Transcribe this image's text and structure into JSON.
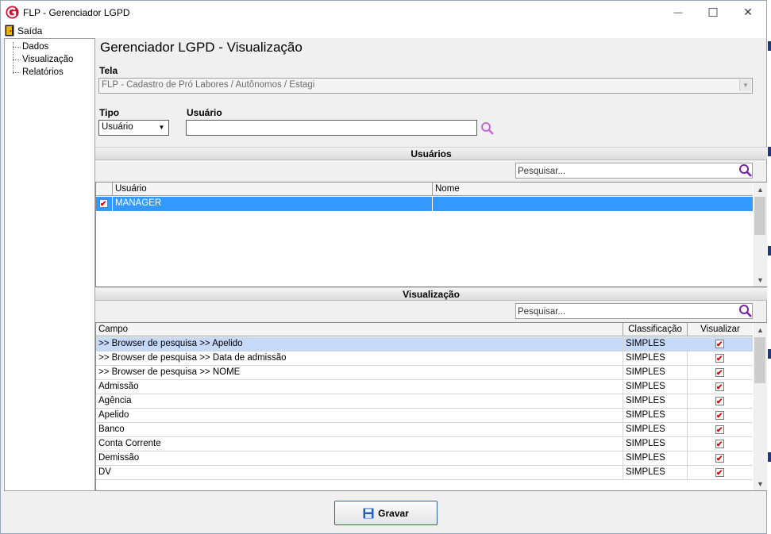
{
  "window": {
    "title": "FLP - Gerenciador LGPD",
    "minimize_glyph": "—",
    "maximize_glyph": "☐",
    "close_glyph": "✕"
  },
  "menu": {
    "exit_label": "Saída",
    "exit_icon": "door-exit-icon"
  },
  "tree": {
    "items": [
      {
        "label": "Dados"
      },
      {
        "label": "Visualização"
      },
      {
        "label": "Relatórios"
      }
    ]
  },
  "page": {
    "title": "Gerenciador LGPD - Visualização"
  },
  "tela": {
    "label": "Tela",
    "value": "FLP - Cadastro de Pró Labores / Autônomos / Estagi"
  },
  "tipo": {
    "label": "Tipo",
    "value": "Usuário"
  },
  "usuario": {
    "label": "Usuário",
    "value": ""
  },
  "usuarios_section": {
    "title": "Usuários",
    "search_placeholder": "Pesquisar...",
    "columns": [
      "Usuário",
      "Nome"
    ],
    "rows": [
      {
        "checked": true,
        "usuario": "MANAGER",
        "nome": ""
      }
    ]
  },
  "visualizacao_section": {
    "title": "Visualização",
    "search_placeholder": "Pesquisar...",
    "columns": [
      "Campo",
      "Classificação",
      "Visualizar"
    ],
    "rows": [
      {
        "campo": ">> Browser de pesquisa >> Apelido",
        "classificacao": "SIMPLES",
        "visualizar": true
      },
      {
        "campo": ">> Browser de pesquisa >> Data de admissão",
        "classificacao": "SIMPLES",
        "visualizar": true
      },
      {
        "campo": ">> Browser de pesquisa >> NOME",
        "classificacao": "SIMPLES",
        "visualizar": true
      },
      {
        "campo": "Admissão",
        "classificacao": "SIMPLES",
        "visualizar": true
      },
      {
        "campo": "Agência",
        "classificacao": "SIMPLES",
        "visualizar": true
      },
      {
        "campo": "Apelido",
        "classificacao": "SIMPLES",
        "visualizar": true
      },
      {
        "campo": "Banco",
        "classificacao": "SIMPLES",
        "visualizar": true
      },
      {
        "campo": "Conta Corrente",
        "classificacao": "SIMPLES",
        "visualizar": true
      },
      {
        "campo": "Demissão",
        "classificacao": "SIMPLES",
        "visualizar": true
      },
      {
        "campo": "DV",
        "classificacao": "SIMPLES",
        "visualizar": true
      }
    ]
  },
  "save_button": {
    "label": "Gravar"
  },
  "colors": {
    "selection": "#3399ff",
    "selection_light": "#c6d9f7",
    "accent_icon": "#7a1fa8",
    "check": "#d00000"
  }
}
